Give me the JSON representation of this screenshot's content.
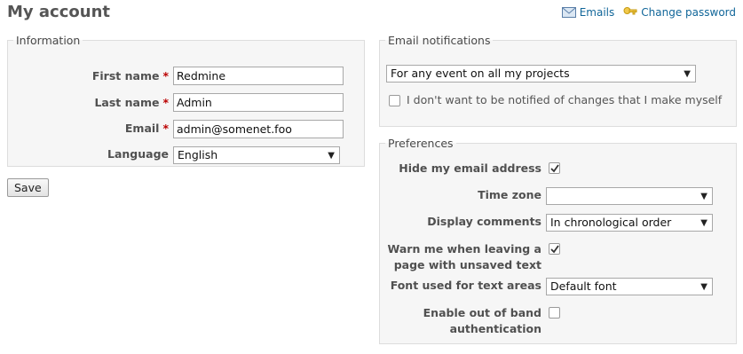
{
  "header": {
    "title": "My account",
    "emails_link": "Emails",
    "change_password_link": "Change password"
  },
  "information": {
    "legend": "Information",
    "first_name_label": "First name",
    "first_name_value": "Redmine",
    "last_name_label": "Last name",
    "last_name_value": "Admin",
    "email_label": "Email",
    "email_value": "admin@somenet.foo",
    "language_label": "Language",
    "language_value": "English",
    "required_marker": "*"
  },
  "save_button": "Save",
  "notifications": {
    "legend": "Email notifications",
    "selected": "For any event on all my projects",
    "no_self_notified_label": "I don't want to be notified of changes that I make myself",
    "no_self_notified_checked": false
  },
  "preferences": {
    "legend": "Preferences",
    "hide_email_label": "Hide my email address",
    "hide_email_checked": true,
    "time_zone_label": "Time zone",
    "time_zone_value": "",
    "display_comments_label": "Display comments",
    "display_comments_value": "In chronological order",
    "warn_unsaved_label_1": "Warn me when leaving a",
    "warn_unsaved_label_2": "page with unsaved text",
    "warn_unsaved_checked": true,
    "font_label": "Font used for text areas",
    "font_value": "Default font",
    "oob_label_1": "Enable out of band",
    "oob_label_2": "authentication",
    "oob_checked": false
  },
  "icons": {
    "select_arrow": "▼",
    "emails_icon": "envelope-icon",
    "change_password_icon": "key-icon"
  }
}
